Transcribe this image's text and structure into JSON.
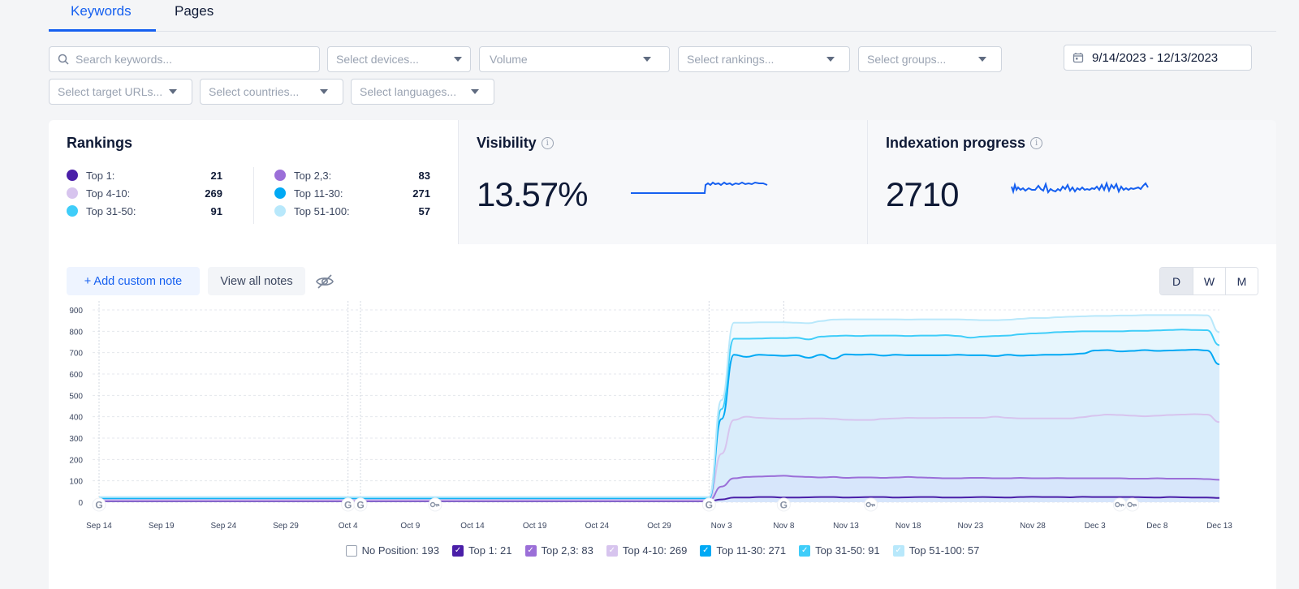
{
  "tabs": [
    {
      "label": "Keywords",
      "active": true
    },
    {
      "label": "Pages",
      "active": false
    }
  ],
  "filters": {
    "search_placeholder": "Search keywords...",
    "devices": "Select devices...",
    "volume": "Volume",
    "rankings": "Select rankings...",
    "groups": "Select groups...",
    "target_urls": "Select target URLs...",
    "countries": "Select countries...",
    "languages": "Select languages...",
    "date_range": "9/14/2023 - 12/13/2023"
  },
  "rankings_card": {
    "title": "Rankings",
    "items": [
      {
        "label": "Top 1:",
        "value": "21",
        "color": "#4a1fa8"
      },
      {
        "label": "Top 4-10:",
        "value": "269",
        "color": "#d7c4ee"
      },
      {
        "label": "Top 31-50:",
        "value": "91",
        "color": "#3fcdf9"
      },
      {
        "label": "Top 2,3:",
        "value": "83",
        "color": "#9b6fd8"
      },
      {
        "label": "Top 11-30:",
        "value": "271",
        "color": "#00a9f4"
      },
      {
        "label": "Top 51-100:",
        "value": "57",
        "color": "#b8e8fb"
      }
    ]
  },
  "visibility_card": {
    "title": "Visibility",
    "value": "13.57%",
    "icon": "info-icon"
  },
  "indexation_card": {
    "title": "Indexation progress",
    "value": "2710",
    "icon": "info-icon"
  },
  "notes": {
    "add_label": "+ Add custom note",
    "view_label": "View all notes",
    "hide_icon": "eye-off-icon"
  },
  "granularity": {
    "options": [
      "D",
      "W",
      "M"
    ],
    "selected": "D"
  },
  "chart_data": {
    "type": "area",
    "title": "",
    "xlabel": "",
    "ylabel": "",
    "ylim": [
      0,
      900
    ],
    "yticks": [
      0,
      100,
      200,
      300,
      400,
      500,
      600,
      700,
      800,
      900
    ],
    "xticks": [
      "Sep 14",
      "Sep 19",
      "Sep 24",
      "Sep 29",
      "Oct 4",
      "Oct 9",
      "Oct 14",
      "Oct 19",
      "Oct 24",
      "Oct 29",
      "Nov 3",
      "Nov 8",
      "Nov 13",
      "Nov 18",
      "Nov 23",
      "Nov 28",
      "Dec 3",
      "Dec 8",
      "Dec 13"
    ],
    "stacked_cumulative": true,
    "grid": true,
    "legend_position": "bottom",
    "day_range": {
      "start": "Sep 14",
      "days": 91
    },
    "series": [
      {
        "name": "Top 1",
        "count": 21,
        "color": "#4a1fa8",
        "before": 5,
        "after": [
          18,
          22,
          22,
          24,
          24,
          22,
          22,
          23,
          24,
          24,
          22,
          22,
          23,
          24,
          24,
          22,
          23,
          24,
          24,
          22,
          22,
          23,
          24,
          23,
          22,
          24,
          25,
          24,
          24,
          23,
          25,
          24,
          24,
          24,
          24,
          24,
          23,
          22,
          24,
          23,
          22,
          22
        ],
        "end": 20
      },
      {
        "name": "Top 2,3",
        "count": 83,
        "color": "#9b6fd8",
        "before": 8,
        "after": [
          125,
          112,
          118,
          120,
          122,
          124,
          120,
          118,
          116,
          118,
          118,
          114,
          116,
          116,
          114,
          116,
          118,
          116,
          114,
          112,
          112,
          114,
          114,
          112,
          112,
          114,
          112,
          112,
          113,
          112,
          112,
          112,
          112,
          112,
          112,
          110,
          110,
          112,
          110,
          110,
          110,
          108
        ],
        "end": 105
      },
      {
        "name": "Top 4-10",
        "count": 269,
        "color": "#d7c4ee",
        "before": 12,
        "after": [
          400,
          385,
          400,
          395,
          392,
          390,
          390,
          392,
          392,
          390,
          388,
          386,
          385,
          385,
          390,
          392,
          395,
          394,
          394,
          395,
          395,
          395,
          395,
          400,
          395,
          392,
          392,
          392,
          392,
          392,
          398,
          402,
          405,
          410,
          408,
          405,
          402,
          405,
          408,
          410,
          412,
          410
        ],
        "end": 375
      },
      {
        "name": "Top 11-30",
        "count": 271,
        "color": "#00a9f4",
        "before": 18,
        "after": [
          690,
          690,
          680,
          690,
          688,
          685,
          688,
          676,
          690,
          672,
          690,
          692,
          690,
          692,
          686,
          690,
          688,
          688,
          688,
          688,
          690,
          688,
          688,
          684,
          690,
          686,
          688,
          690,
          690,
          692,
          696,
          700,
          710,
          712,
          706,
          708,
          712,
          708,
          710,
          712,
          714,
          710
        ],
        "end": 645
      },
      {
        "name": "Top 31-50",
        "count": 91,
        "color": "#3fcdf9",
        "before": 22,
        "after": [
          770,
          765,
          765,
          766,
          768,
          768,
          770,
          762,
          775,
          778,
          778,
          780,
          778,
          780,
          780,
          780,
          778,
          780,
          780,
          782,
          778,
          770,
          775,
          778,
          780,
          786,
          790,
          792,
          796,
          798,
          800,
          800,
          800,
          800,
          800,
          802,
          802,
          804,
          806,
          808,
          806,
          805
        ],
        "end": 735
      },
      {
        "name": "Top 51-100",
        "count": 57,
        "color": "#b8e8fb",
        "before": 24,
        "after": [
          845,
          840,
          840,
          842,
          842,
          842,
          840,
          838,
          848,
          855,
          856,
          856,
          856,
          856,
          856,
          856,
          855,
          856,
          856,
          856,
          856,
          854,
          852,
          852,
          854,
          858,
          862,
          862,
          866,
          868,
          870,
          870,
          872,
          872,
          874,
          874,
          876,
          876,
          876,
          876,
          876,
          875
        ],
        "end": 795
      }
    ],
    "markers": [
      {
        "date": "Sep 14",
        "type": "google-update"
      },
      {
        "date": "Oct 4",
        "type": "google-update"
      },
      {
        "date": "Oct 5",
        "type": "google-update"
      },
      {
        "date": "Oct 11",
        "type": "key-note"
      },
      {
        "date": "Nov 2",
        "type": "google-update"
      },
      {
        "date": "Nov 8",
        "type": "google-update"
      },
      {
        "date": "Nov 15",
        "type": "key-note"
      },
      {
        "date": "Dec 5",
        "type": "key-note"
      },
      {
        "date": "Dec 6",
        "type": "key-note"
      }
    ]
  },
  "legend": [
    {
      "label": "No Position: 193",
      "checked": false,
      "color": "#ffffff"
    },
    {
      "label": "Top 1: 21",
      "checked": true,
      "color": "#4a1fa8"
    },
    {
      "label": "Top 2,3: 83",
      "checked": true,
      "color": "#9b6fd8"
    },
    {
      "label": "Top 4-10: 269",
      "checked": true,
      "color": "#d7c4ee"
    },
    {
      "label": "Top 11-30: 271",
      "checked": true,
      "color": "#00a9f4"
    },
    {
      "label": "Top 31-50: 91",
      "checked": true,
      "color": "#3fcdf9"
    },
    {
      "label": "Top 51-100: 57",
      "checked": true,
      "color": "#b8e8fb"
    }
  ]
}
